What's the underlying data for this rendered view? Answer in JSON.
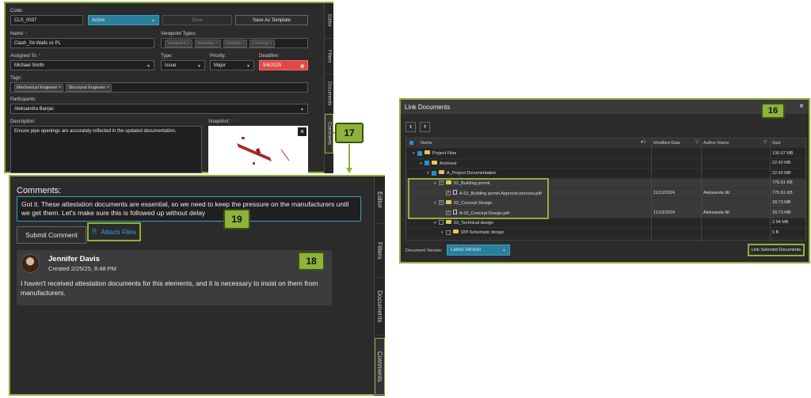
{
  "top_panel": {
    "code_label": "Code:",
    "code_value": "CLS_0037",
    "status_value": "Active",
    "save_label": "Save",
    "save_template_label": "Save As Template",
    "name_label": "Name:",
    "name_value": "Clash_Str.Walls vs PL",
    "viewpoint_label": "Viewpoint Types:",
    "viewpoint_chips": [
      "Viewpoint",
      "Selection",
      "Visibility",
      "Coloring"
    ],
    "assigned_label": "Assigned To:",
    "assigned_value": "Michael Smith",
    "type_label": "Type:",
    "type_value": "Issue",
    "priority_label": "Priority:",
    "priority_value": "Major",
    "deadline_label": "Deadline:",
    "deadline_value": "5/6/2025",
    "tags_label": "Tags:",
    "tags": [
      "Mechanical Engineer",
      "Structural Engineer"
    ],
    "participants_label": "Participants:",
    "participants_value": "Aleksandra Banjac",
    "description_label": "Description:",
    "description_value": "Ensure pipe openings are accurately reflected in the updated documentation.",
    "snapshot_label": "Snapshot:",
    "tabs": [
      "Editor",
      "Filters",
      "Documents",
      "Comments"
    ]
  },
  "comments_panel": {
    "title": "Comments:",
    "comment_text": "Got it. These attestation documents are essential, so we need to keep the pressure on the manufacturers until we get them. Let's make sure this is followed up without delay",
    "submit_label": "Submit Comment",
    "attach_label": "Attach Files",
    "comment": {
      "author": "Jennifer Davis",
      "created": "Created 2/25/25, 8:48 PM",
      "text": "I haven't received attestation documents for this elements, and it is necessary to insist on them from manufacturers."
    },
    "tabs": [
      "Editor",
      "Filters",
      "Documents",
      "Comments"
    ]
  },
  "link_documents": {
    "title": "Link Documents",
    "close": "×",
    "col_name": "Name",
    "col_modified": "Modified Date",
    "col_author": "Author Name",
    "col_size": "Size",
    "rows": [
      {
        "name": "Project Files",
        "modified": "",
        "author": "",
        "size": "130.57 MB"
      },
      {
        "name": "Archived",
        "modified": "",
        "author": "",
        "size": "22.42 MB"
      },
      {
        "name": "A_Project Documentation",
        "modified": "",
        "author": "",
        "size": "22.42 MB"
      },
      {
        "name": "01_Building permit",
        "modified": "",
        "author": "",
        "size": "775.61 KB"
      },
      {
        "name": "A-01_Building permit Approval process.pdf",
        "modified": "11/13/2024",
        "author": "Aleksanda Ilić",
        "size": "775.61 KB"
      },
      {
        "name": "02_Concept Design",
        "modified": "",
        "author": "",
        "size": "18.73 MB"
      },
      {
        "name": "A-02_Concept Design.pdf",
        "modified": "11/13/2024",
        "author": "Aleksanda Ilić",
        "size": "18.73 MB"
      },
      {
        "name": "03_Technical design",
        "modified": "",
        "author": "",
        "size": "2.94 MB"
      },
      {
        "name": "IDP-Schematic design",
        "modified": "",
        "author": "",
        "size": "0 B"
      }
    ],
    "version_label": "Document Version:",
    "version_value": "Latest Version",
    "link_label": "Link Selected Documents"
  },
  "badges": {
    "b16": "16",
    "b17": "17",
    "b18": "18",
    "b19": "19"
  }
}
